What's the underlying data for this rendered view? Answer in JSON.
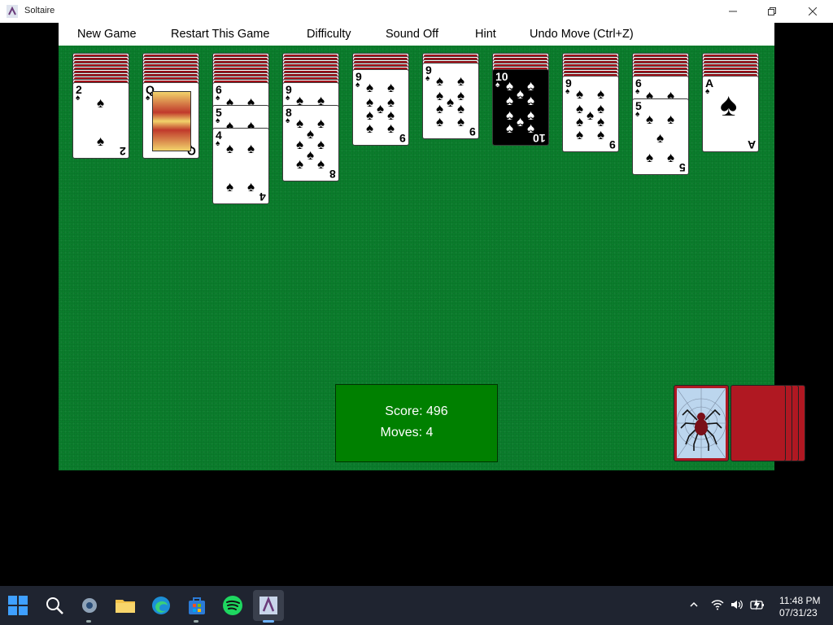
{
  "window": {
    "title": "Soltaire",
    "min_icon": "minimize-icon",
    "max_icon": "restore-icon",
    "close_icon": "close-icon"
  },
  "menu": [
    "New Game",
    "Restart This Game",
    "Difficulty",
    "Sound Off",
    "Hint",
    "Undo Move (Ctrl+Z)"
  ],
  "colors": {
    "felt": "#0b7d2c",
    "card_back": "#c0121c",
    "score_box": "#008000",
    "taskbar": "#1f2430"
  },
  "tableau": [
    {
      "faces": [
        {
          "rank": "2",
          "suit": "♠"
        }
      ]
    },
    {
      "faces": [
        {
          "rank": "Q",
          "suit": "♠",
          "court": true
        }
      ]
    },
    {
      "faces": [
        {
          "rank": "6",
          "suit": "♠"
        },
        {
          "rank": "5",
          "suit": "♠"
        },
        {
          "rank": "4",
          "suit": "♠"
        }
      ]
    },
    {
      "faces": [
        {
          "rank": "9",
          "suit": "♠"
        },
        {
          "rank": "8",
          "suit": "♠"
        }
      ]
    },
    {
      "faces": [
        {
          "rank": "9",
          "suit": "♠"
        }
      ]
    },
    {
      "faces": [
        {
          "rank": "9",
          "suit": "♠"
        }
      ]
    },
    {
      "faces": [
        {
          "rank": "10",
          "suit": "♠",
          "highlighted": true
        }
      ]
    },
    {
      "faces": [
        {
          "rank": "9",
          "suit": "♠"
        }
      ]
    },
    {
      "faces": [
        {
          "rank": "6",
          "suit": "♠"
        },
        {
          "rank": "5",
          "suit": "♠"
        }
      ]
    },
    {
      "faces": [
        {
          "rank": "A",
          "suit": "♠"
        }
      ]
    }
  ],
  "score": {
    "score_text": "Score: 496",
    "moves_text": "Moves: 4"
  },
  "stock": {
    "icon": "spider-icon"
  },
  "taskbar": {
    "apps": [
      "start-icon",
      "search-icon",
      "settings-icon",
      "file-explorer-icon",
      "edge-icon",
      "store-icon",
      "spotify-icon",
      "solitaire-icon"
    ],
    "time": "11:48 PM",
    "date": "07/31/23"
  }
}
